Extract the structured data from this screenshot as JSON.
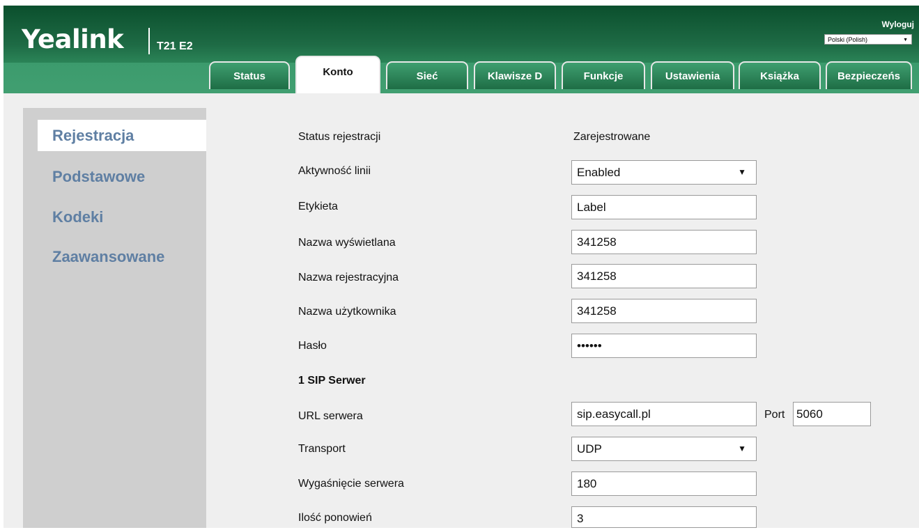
{
  "header": {
    "logo": "Yealink",
    "model": "T21 E2",
    "logout": "Wyloguj",
    "language": "Polski (Polish)"
  },
  "tabs": [
    "Status",
    "Konto",
    "Sieć",
    "Klawisze D",
    "Funkcje",
    "Ustawienia",
    "Książka",
    "Bezpieczeńs"
  ],
  "active_tab": "Konto",
  "sidebar": {
    "items": [
      "Rejestracja",
      "Podstawowe",
      "Kodeki",
      "Zaawansowane"
    ],
    "active": "Rejestracja"
  },
  "form": {
    "status_label": "Status rejestracji",
    "status_value": "Zarejestrowane",
    "line_label": "Aktywność linii",
    "line_value": "Enabled",
    "label_label": "Etykieta",
    "label_value": "Label",
    "display_label": "Nazwa wyświetlana",
    "display_value": "341258",
    "register_label": "Nazwa rejestracyjna",
    "register_value": "341258",
    "user_label": "Nazwa użytkownika",
    "user_value": "341258",
    "password_label": "Hasło",
    "password_value": "••••••",
    "sip_section": "1 SIP Serwer",
    "server_url_label": "URL serwera",
    "server_url_value": "sip.easycall.pl",
    "port_label": "Port",
    "port_value": "5060",
    "transport_label": "Transport",
    "transport_value": "UDP",
    "expiry_label": "Wygaśnięcie serwera",
    "expiry_value": "180",
    "retry_label": "Ilość ponowień",
    "retry_value": "3"
  },
  "icons": {
    "dropdown_arrow": "▼"
  }
}
